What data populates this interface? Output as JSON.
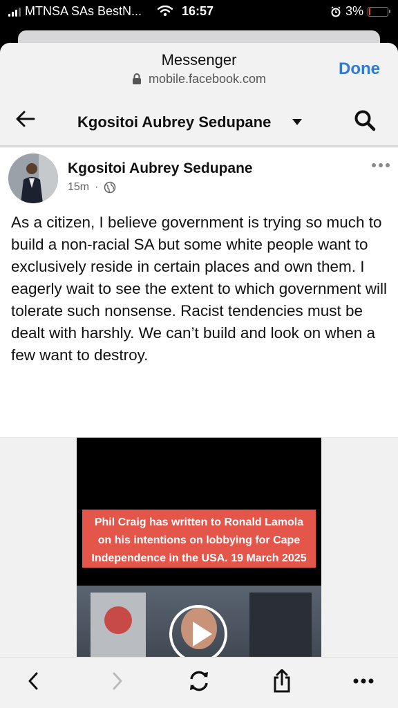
{
  "status_bar": {
    "carrier": "MTNSA SAs BestN...",
    "time": "16:57",
    "battery": "3%"
  },
  "browser": {
    "title": "Messenger",
    "url": "mobile.facebook.com",
    "done_label": "Done"
  },
  "nav": {
    "title": "Kgositoi Aubrey Sedupane"
  },
  "post": {
    "author": "Kgositoi Aubrey Sedupane",
    "time": "15m",
    "separator": "·",
    "text": "As a citizen, I believe  government is  trying so much to build a non-racial SA but some white people want to exclusively reside in certain places and own them. I eagerly wait to see the extent to which government will tolerate such nonsense. Racist tendencies must be dealt with harshly. We can’t build and look on when a few want to destroy.",
    "video_caption": "Phil Craig has written to Ronald Lamola on his intentions on lobbying for  Cape Independence in the USA.  19 March 2025"
  },
  "colors": {
    "accent": "#2f7ad9",
    "caption_bg": "#e4554a"
  },
  "icons": {
    "back": "arrow-left-icon",
    "search": "search-icon",
    "lock": "lock-icon",
    "globe": "globe-icon",
    "play": "play-icon"
  }
}
